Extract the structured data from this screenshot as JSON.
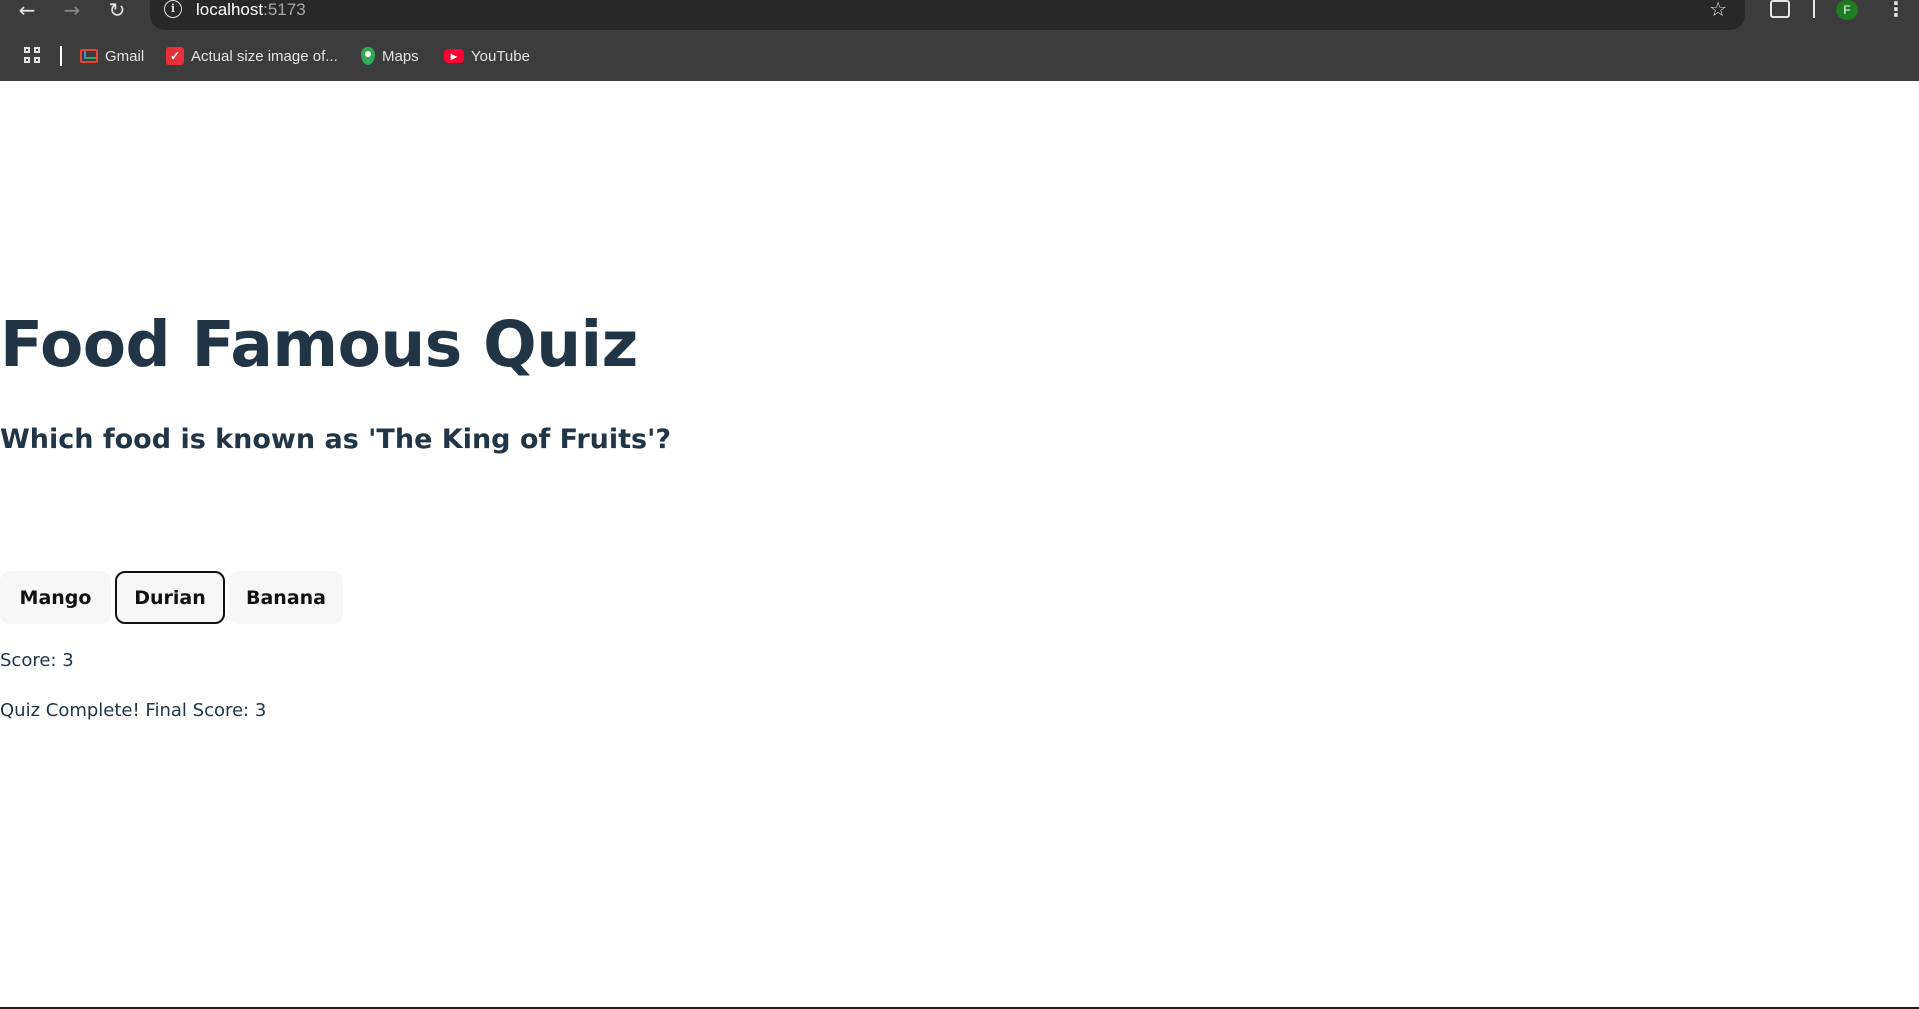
{
  "browser": {
    "url_host": "localhost",
    "url_port": ":5173",
    "avatar_letter": "F",
    "bookmarks": [
      {
        "label": "Gmail",
        "icon": "gmail-icon"
      },
      {
        "label": "Actual size image of...",
        "icon": "bolt-icon"
      },
      {
        "label": "Maps",
        "icon": "maps-icon"
      },
      {
        "label": "YouTube",
        "icon": "youtube-icon"
      }
    ]
  },
  "quiz": {
    "title": "Food Famous Quiz",
    "question": "Which food is known as 'The King of Fruits'?",
    "options": [
      {
        "label": "Mango",
        "selected": false
      },
      {
        "label": "Durian",
        "selected": true
      },
      {
        "label": "Banana",
        "selected": false
      }
    ],
    "score_text": "Score: 3",
    "complete_text": "Quiz Complete! Final Score: 3"
  },
  "colors": {
    "heading": "#213547",
    "browser_bg": "#3c3c3c",
    "omnibox_bg": "#282828",
    "button_bg": "#f7f7f7",
    "selected_border": "#111111"
  }
}
